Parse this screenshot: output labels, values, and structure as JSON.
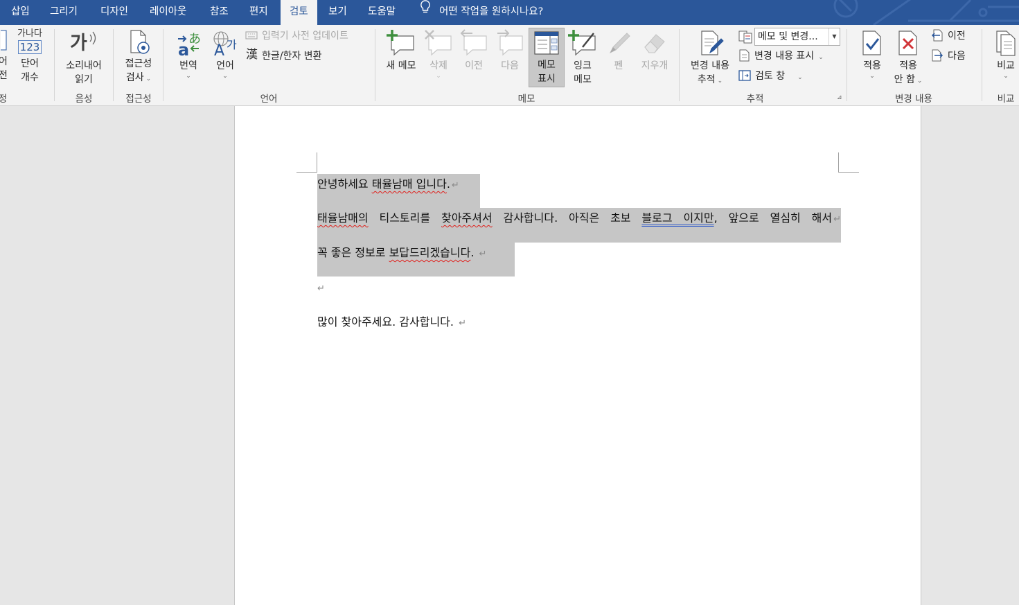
{
  "tabs": {
    "insert": "삽입",
    "draw": "그리기",
    "design": "디자인",
    "layout": "레이아웃",
    "references": "참조",
    "mailings": "편지",
    "review": "검토",
    "view": "보기",
    "help": "도움말",
    "tell_me": "어떤 작업을 원하시나요?"
  },
  "ribbon": {
    "proofing": {
      "clipped_button_line1": "어",
      "clipped_button_line2": "전",
      "clipped_group_label": "정",
      "word_count_icon_text1": "가나다",
      "word_count_icon_text2": "123",
      "word_count_line1": "단어",
      "word_count_line2": "개수"
    },
    "speech": {
      "icon_text": "가",
      "read_aloud_line1": "소리내어",
      "read_aloud_line2": "읽기",
      "group_label": "음성"
    },
    "accessibility": {
      "check_line1": "접근성",
      "check_line2": "검사",
      "group_label": "접근성"
    },
    "language": {
      "translate": "번역",
      "language": "언어",
      "ime_dictionary": "입력기 사전 업데이트",
      "hanja_icon": "漢",
      "hangul_hanja": "한글/한자 변환",
      "group_label": "언어"
    },
    "comments": {
      "new_comment": "새 메모",
      "delete": "삭제",
      "previous": "이전",
      "next": "다음",
      "show_line1": "메모",
      "show_line2": "표시",
      "ink_line1": "잉크",
      "ink_line2": "메모",
      "pen": "펜",
      "eraser": "지우개",
      "group_label": "메모"
    },
    "tracking": {
      "track_line1": "변경 내용",
      "track_line2": "추적",
      "markup_select_value": "메모 및 변경...",
      "show_markup": "변경 내용 표시",
      "reviewing_pane": "검토 창",
      "group_label": "추적"
    },
    "changes": {
      "accept": "적용",
      "reject_line1": "적용",
      "reject_line2": "안 함",
      "previous": "이전",
      "next": "다음",
      "group_label": "변경 내용"
    },
    "compare": {
      "compare": "비교",
      "group_label": "비교"
    }
  },
  "document": {
    "line1": {
      "a": "안녕하세요 ",
      "b": "태율남매 입니다",
      "c": "."
    },
    "line2": {
      "a": "태율남매의",
      "b": " 티스토리를 ",
      "c": "찾아주셔서",
      "d": " 감사합니다. 아직은 초보 ",
      "e": "블로그 이지만",
      "f": ", 앞으로 열심히 해서"
    },
    "line3": {
      "a": "꼭 좋은 정보로 ",
      "b": "보답드리겠습니다",
      "c": ". "
    },
    "line5": "많이 찾아주세요. 감사합니다. ",
    "paragraph_mark": "↵"
  },
  "colors": {
    "title_bar": "#2b579a",
    "ribbon_bg": "#f3f3f3",
    "selection": "#c6c6c6",
    "spell_underline": "#e0201c",
    "grammar_underline": "#2b57c9"
  }
}
